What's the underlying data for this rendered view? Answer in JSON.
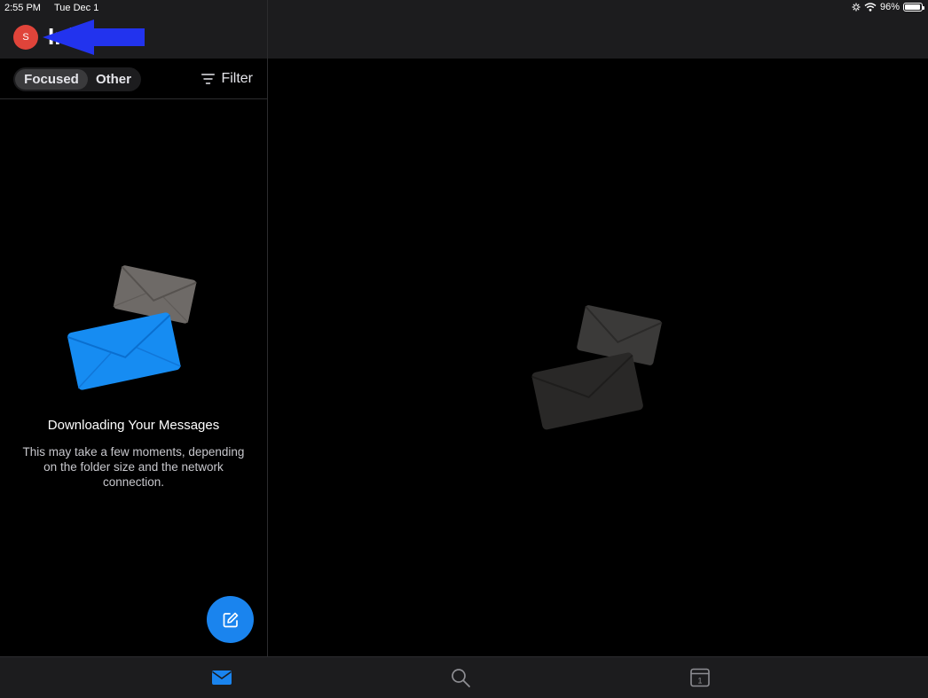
{
  "status_bar": {
    "time": "2:55 PM",
    "date": "Tue Dec 1",
    "battery": "96%",
    "battery_level": 0.96,
    "icons": [
      "signal-icon",
      "wifi-icon",
      "battery-icon"
    ]
  },
  "header": {
    "avatar_initial": "S",
    "title": "Inbox"
  },
  "annotation": {
    "icon": "arrow-left-icon",
    "color": "#2233ee"
  },
  "toolbar": {
    "tabs": [
      {
        "label": "Focused",
        "selected": true
      },
      {
        "label": "Other",
        "selected": false
      }
    ],
    "filter_label": "Filter",
    "filter_icon": "filter-icon"
  },
  "empty_state": {
    "title": "Downloading Your Messages",
    "description": "This may take a few moments, depending on the folder size and the network connection."
  },
  "compose": {
    "icon": "compose-icon"
  },
  "tabbar": {
    "items": [
      {
        "name": "mail",
        "icon": "mail-icon",
        "selected": true
      },
      {
        "name": "search",
        "icon": "search-icon",
        "selected": false
      },
      {
        "name": "calendar",
        "icon": "calendar-icon",
        "selected": false,
        "day": "1"
      }
    ]
  },
  "colors": {
    "accent": "#1a84ee",
    "avatar": "#e0443a",
    "background": "#000000",
    "bar": "#1c1c1e"
  }
}
